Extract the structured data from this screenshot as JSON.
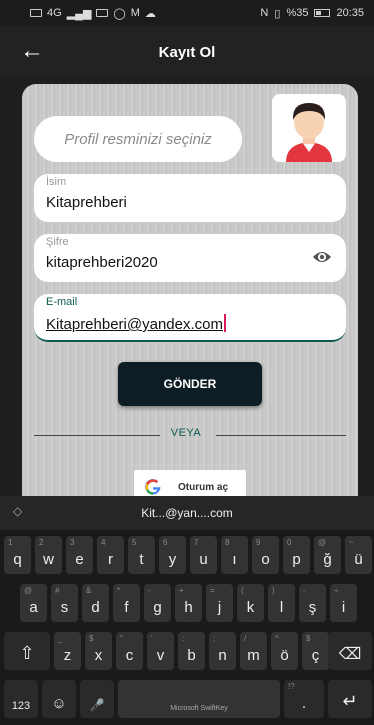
{
  "status_bar": {
    "signal": "4G",
    "battery_text": "%35",
    "time": "20:35"
  },
  "app_bar": {
    "title": "Kayıt Ol"
  },
  "form": {
    "profile_placeholder": "Profil resminizi seçiniz",
    "name": {
      "label": "İsim",
      "value": "Kitaprehberi"
    },
    "password": {
      "label": "Şifre",
      "value": "kitaprehberi2020"
    },
    "email": {
      "label": "E-mail",
      "value": "Kitaprehberi@yandex.com"
    },
    "submit_label": "GÖNDER",
    "or_label": "VEYA",
    "google_label": "Oturum aç"
  },
  "keyboard": {
    "suggestion": "Kit...@yan....com",
    "row1": [
      {
        "k": "q",
        "h": "1"
      },
      {
        "k": "w",
        "h": "2"
      },
      {
        "k": "e",
        "h": "3"
      },
      {
        "k": "r",
        "h": "4"
      },
      {
        "k": "t",
        "h": "5"
      },
      {
        "k": "y",
        "h": "6"
      },
      {
        "k": "u",
        "h": "7"
      },
      {
        "k": "ı",
        "h": "8"
      },
      {
        "k": "o",
        "h": "9"
      },
      {
        "k": "p",
        "h": "0"
      },
      {
        "k": "ğ",
        "h": "@"
      },
      {
        "k": "ü",
        "h": "~"
      }
    ],
    "row2": [
      {
        "k": "a",
        "h": "@"
      },
      {
        "k": "s",
        "h": "#"
      },
      {
        "k": "d",
        "h": "&"
      },
      {
        "k": "f",
        "h": "*"
      },
      {
        "k": "g",
        "h": "-"
      },
      {
        "k": "h",
        "h": "+"
      },
      {
        "k": "j",
        "h": "="
      },
      {
        "k": "k",
        "h": "("
      },
      {
        "k": "l",
        "h": ")"
      },
      {
        "k": "ş",
        "h": "-"
      },
      {
        "k": "i",
        "h": "÷"
      }
    ],
    "row3": [
      {
        "k": "z",
        "h": "_"
      },
      {
        "k": "x",
        "h": "$"
      },
      {
        "k": "c",
        "h": "\""
      },
      {
        "k": "v",
        "h": "'"
      },
      {
        "k": "b",
        "h": ":"
      },
      {
        "k": "n",
        "h": ";"
      },
      {
        "k": "m",
        "h": "/"
      },
      {
        "k": "ö",
        "h": "^"
      },
      {
        "k": "ç",
        "h": "$"
      }
    ],
    "num_key": "123",
    "space_label": "Microsoft SwiftKey",
    "punct_hint": "!?"
  }
}
